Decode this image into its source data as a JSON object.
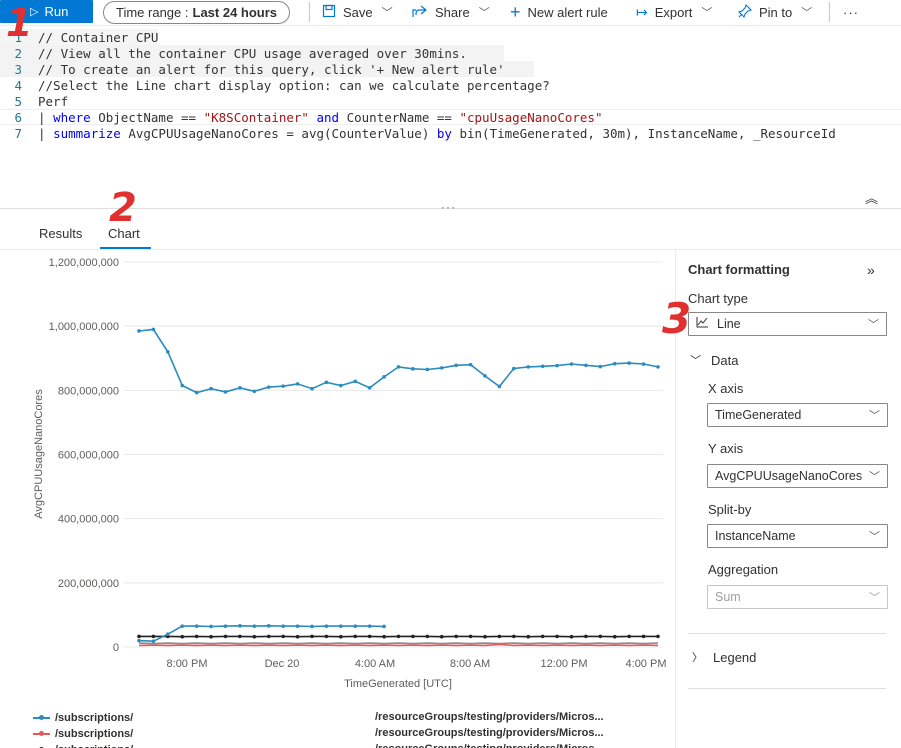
{
  "toolbar": {
    "run_label": "Run",
    "time_range_label": "Time range :",
    "time_range_value": "Last 24 hours",
    "save_label": "Save",
    "share_label": "Share",
    "new_alert_label": "New alert rule",
    "export_label": "Export",
    "pin_label": "Pin to",
    "more_label": "···"
  },
  "editor": {
    "lines": [
      {
        "num": "1",
        "text": "// Container CPU"
      },
      {
        "num": "2",
        "text": "// View all the container CPU usage averaged over 30mins."
      },
      {
        "num": "3",
        "text": "// To create an alert for this query, click '+ New alert rule'"
      },
      {
        "num": "4",
        "text": "//Select the Line chart display option: can we calculate percentage?"
      },
      {
        "num": "5",
        "text": "Perf"
      },
      {
        "num": "6",
        "text": "| where ObjectName == \"K8SContainer\" and CounterName == \"cpuUsageNanoCores\""
      },
      {
        "num": "7",
        "text": "| summarize AvgCPUUsageNanoCores = avg(CounterValue) by bin(TimeGenerated, 30m), InstanceName, _ResourceId"
      }
    ],
    "splitter_dots": "···"
  },
  "tabs": [
    {
      "label": "Results"
    },
    {
      "label": "Chart"
    }
  ],
  "annotations": [
    "1",
    "2",
    "3"
  ],
  "chart_data": {
    "type": "line",
    "title": "",
    "xlabel": "TimeGenerated [UTC]",
    "ylabel": "AvgCPUUsageNanoCores",
    "ylim": [
      0,
      1200000000
    ],
    "y_ticks": [
      "1,200,000,000",
      "1,000,000,000",
      "800,000,000",
      "600,000,000",
      "400,000,000",
      "200,000,000",
      "0"
    ],
    "x_ticks": [
      "8:00 PM",
      "Dec 20",
      "4:00 AM",
      "8:00 AM",
      "12:00 PM",
      "4:00 PM"
    ],
    "grid": true,
    "legend": "bottom",
    "x_index_range": [
      0,
      36
    ],
    "series": [
      {
        "color": "#2b8cbe",
        "marker": true,
        "values": [
          985000000,
          990000000,
          920000000,
          815000000,
          793000000,
          805000000,
          795000000,
          808000000,
          797000000,
          810000000,
          813000000,
          820000000,
          805000000,
          825000000,
          815000000,
          828000000,
          808000000,
          842000000,
          873000000,
          867000000,
          865000000,
          870000000,
          878000000,
          880000000,
          845000000,
          812000000,
          868000000,
          873000000,
          875000000,
          877000000,
          882000000,
          878000000,
          874000000,
          883000000,
          885000000,
          882000000,
          873000000
        ]
      },
      {
        "color": "#2b8cbe",
        "marker": true,
        "values": [
          20000000,
          18000000,
          40000000,
          65000000,
          65000000,
          64000000,
          65000000,
          66000000,
          65000000,
          66000000,
          65000000,
          65000000,
          64000000,
          65000000,
          65000000,
          65000000,
          65000000,
          64000000
        ]
      },
      {
        "color": "#222222",
        "marker": true,
        "values": [
          33000000,
          33000000,
          33000000,
          32000000,
          33000000,
          32000000,
          33000000,
          33000000,
          32000000,
          33000000,
          33000000,
          32000000,
          33000000,
          33000000,
          32000000,
          33000000,
          33000000,
          32000000,
          33000000,
          33000000,
          33000000,
          32000000,
          33000000,
          33000000,
          32000000,
          33000000,
          33000000,
          32000000,
          33000000,
          33000000,
          32000000,
          33000000,
          33000000,
          32000000,
          33000000,
          33000000,
          33000000
        ]
      },
      {
        "color": "#e05a5a",
        "marker": false,
        "values": [
          5000000,
          6000000,
          5000000,
          6000000,
          5000000,
          6000000,
          5000000,
          6000000,
          5000000,
          6000000,
          5000000,
          6000000,
          5000000,
          6000000,
          5000000,
          6000000,
          5000000,
          6000000,
          5000000,
          6000000,
          5000000,
          6000000,
          5000000,
          6000000,
          5000000,
          8000000,
          5000000,
          6000000,
          5000000,
          6000000,
          5000000,
          6000000,
          5000000,
          6000000,
          5000000,
          6000000,
          5000000
        ]
      },
      {
        "color": "#8c8c8c",
        "marker": false,
        "values": [
          12000000,
          11000000,
          12000000,
          11000000,
          12000000,
          11000000,
          12000000,
          11000000,
          12000000,
          11000000,
          12000000,
          11000000,
          12000000,
          11000000,
          12000000,
          11000000,
          12000000,
          11000000,
          12000000,
          11000000,
          12000000,
          11000000,
          12000000,
          11000000,
          12000000,
          11000000,
          12000000,
          11000000,
          12000000,
          11000000,
          12000000,
          11000000,
          12000000,
          11000000,
          12000000,
          11000000,
          12000000
        ]
      }
    ],
    "legend_entries": [
      {
        "left": "/subscriptions/",
        "right": "/resourceGroups/testing/providers/Micros...",
        "color": "#2b8cbe"
      },
      {
        "left": "/subscriptions/",
        "right": "/resourceGroups/testing/providers/Micros...",
        "color": "#e05a5a"
      },
      {
        "left": "/subscriptions/",
        "right": "/resourceGroups/testing/providers/Micros...",
        "color": "#222222"
      }
    ]
  },
  "pane": {
    "title": "Chart formatting",
    "chart_type_label": "Chart type",
    "chart_type_value": "Line",
    "data_section": "Data",
    "x_axis_label": "X axis",
    "x_axis_value": "TimeGenerated",
    "y_axis_label": "Y axis",
    "y_axis_value": "AvgCPUUsageNanoCores",
    "split_label": "Split-by",
    "split_value": "InstanceName",
    "aggregation_label": "Aggregation",
    "aggregation_value": "Sum",
    "legend_section": "Legend"
  }
}
